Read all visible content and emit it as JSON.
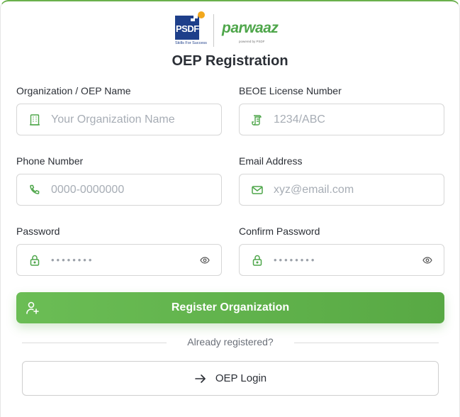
{
  "header": {
    "psdf_logo_text": "PSDF",
    "psdf_tagline": "Skills For Success",
    "parwaaz_logo_text": "parwaaz",
    "parwaaz_tagline": "powered by PSDF",
    "title": "OEP Registration"
  },
  "form": {
    "org_name": {
      "label": "Organization / OEP Name",
      "placeholder": "Your Organization Name",
      "value": "",
      "icon": "building-icon"
    },
    "license": {
      "label": "BEOE License Number",
      "placeholder": "1234/ABC",
      "value": "",
      "icon": "document-icon"
    },
    "phone": {
      "label": "Phone Number",
      "placeholder": "0000-0000000",
      "value": "",
      "icon": "phone-icon"
    },
    "email": {
      "label": "Email Address",
      "placeholder": "xyz@email.com",
      "value": "",
      "icon": "mail-icon"
    },
    "password": {
      "label": "Password",
      "placeholder": "••••••••",
      "value": "",
      "icon": "lock-icon"
    },
    "confirm_password": {
      "label": "Confirm Password",
      "placeholder": "••••••••",
      "value": "",
      "icon": "lock-icon"
    }
  },
  "actions": {
    "register_label": "Register Organization",
    "divider_text": "Already registered?",
    "login_label": "OEP Login"
  },
  "colors": {
    "accent": "#5fb24b",
    "icon_green": "#4ea64a",
    "border": "#d6d6d6"
  }
}
